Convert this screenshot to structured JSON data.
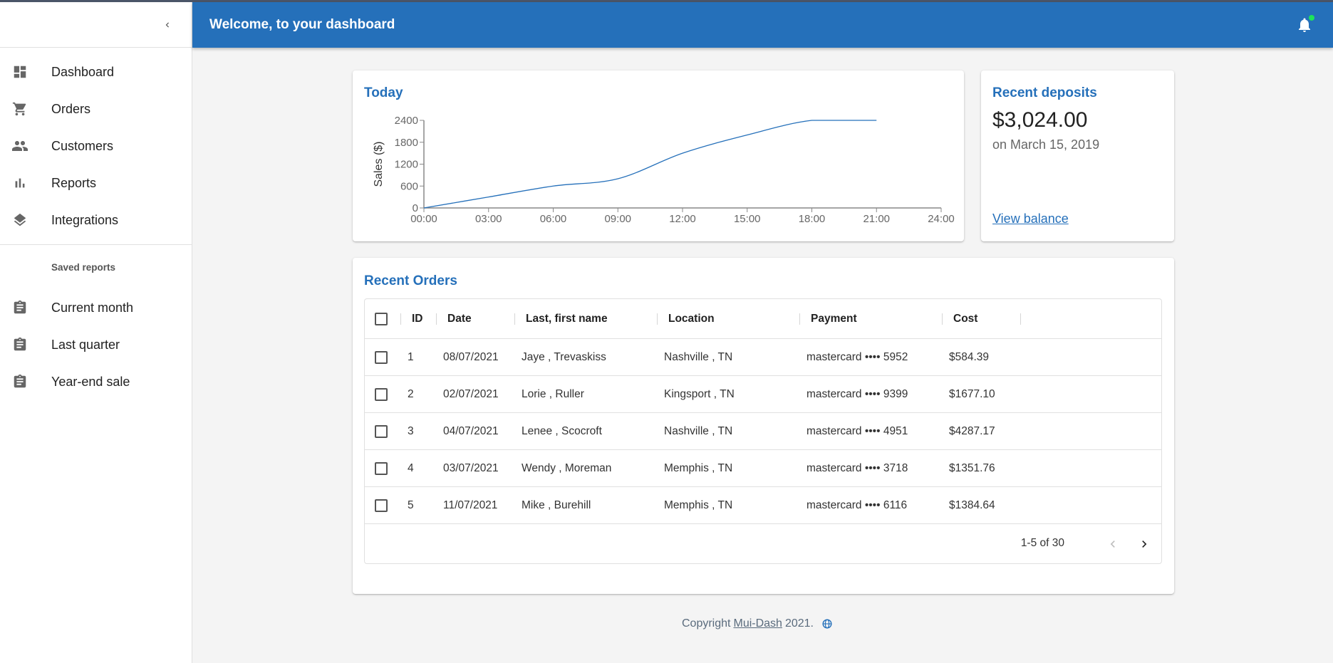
{
  "sidebar": {
    "nav_items": [
      {
        "label": "Dashboard",
        "icon": "dashboard-icon"
      },
      {
        "label": "Orders",
        "icon": "shopping-cart-icon"
      },
      {
        "label": "Customers",
        "icon": "people-icon"
      },
      {
        "label": "Reports",
        "icon": "bar-chart-icon"
      },
      {
        "label": "Integrations",
        "icon": "layers-icon"
      }
    ],
    "subheader": "Saved reports",
    "saved_reports": [
      {
        "label": "Current month",
        "icon": "assignment-icon"
      },
      {
        "label": "Last quarter",
        "icon": "assignment-icon"
      },
      {
        "label": "Year-end sale",
        "icon": "assignment-icon"
      }
    ]
  },
  "header": {
    "title": "Welcome, to your dashboard",
    "notification_badge_color": "#1de35a"
  },
  "colors": {
    "primary": "#2570ba",
    "background": "#f4f4f4"
  },
  "today": {
    "title": "Today"
  },
  "chart_data": {
    "type": "line",
    "title": "Today",
    "xlabel": "",
    "ylabel": "Sales ($)",
    "x": [
      "00:00",
      "03:00",
      "06:00",
      "09:00",
      "12:00",
      "15:00",
      "18:00",
      "21:00",
      "24:00"
    ],
    "values": [
      0,
      300,
      600,
      800,
      1500,
      2000,
      2400,
      2400,
      null
    ],
    "yticks": [
      0,
      600,
      1200,
      1800,
      2400
    ],
    "ylim": [
      0,
      2400
    ],
    "grid": false,
    "line_color": "#2570ba"
  },
  "deposits": {
    "title": "Recent deposits",
    "amount": "$3,024.00",
    "date": "on March 15, 2019",
    "link": "View balance"
  },
  "orders": {
    "title": "Recent Orders",
    "columns": [
      "ID",
      "Date",
      "Last, first name",
      "Location",
      "Payment",
      "Cost"
    ],
    "rows": [
      {
        "id": "1",
        "date": "08/07/2021",
        "name": "Jaye , Trevaskiss",
        "location": "Nashville , TN",
        "payment": "mastercard •••• 5952",
        "cost": "$584.39"
      },
      {
        "id": "2",
        "date": "02/07/2021",
        "name": "Lorie , Ruller",
        "location": "Kingsport , TN",
        "payment": "mastercard •••• 9399",
        "cost": "$1677.10"
      },
      {
        "id": "3",
        "date": "04/07/2021",
        "name": "Lenee , Scocroft",
        "location": "Nashville , TN",
        "payment": "mastercard •••• 4951",
        "cost": "$4287.17"
      },
      {
        "id": "4",
        "date": "03/07/2021",
        "name": "Wendy , Moreman",
        "location": "Memphis , TN",
        "payment": "mastercard •••• 3718",
        "cost": "$1351.76"
      },
      {
        "id": "5",
        "date": "11/07/2021",
        "name": "Mike , Burehill",
        "location": "Memphis , TN",
        "payment": "mastercard •••• 6116",
        "cost": "$1384.64"
      }
    ],
    "pagination": "1-5 of 30"
  },
  "footer": {
    "prefix": "Copyright",
    "link": "Mui-Dash",
    "suffix": "2021."
  }
}
